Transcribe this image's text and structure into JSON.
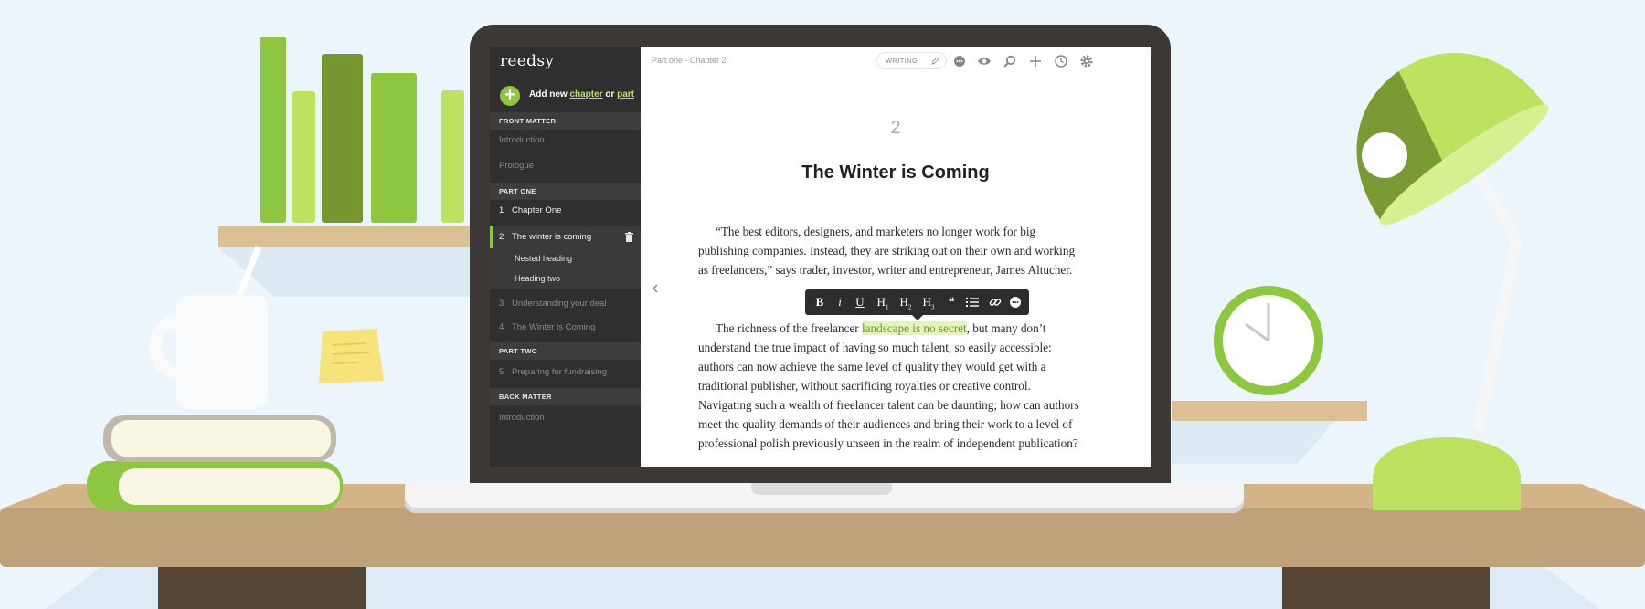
{
  "app": {
    "logo": "reedsy"
  },
  "sidebar": {
    "add_new": {
      "prefix": "Add new ",
      "chapter": "chapter",
      "or": " or ",
      "part": "part"
    },
    "front_matter": {
      "heading": "FRONT MATTER",
      "items": [
        "Introduction",
        "Prologue"
      ]
    },
    "part_one": {
      "heading": "PART ONE",
      "items": [
        {
          "num": "1",
          "label": "Chapter One"
        },
        {
          "num": "2",
          "label": "The winter is coming"
        },
        {
          "num": "3",
          "label": "Understanding your deal"
        },
        {
          "num": "4",
          "label": "The Winter is Coming"
        }
      ],
      "sub_headings": [
        "Nested heading",
        "Heading two"
      ]
    },
    "part_two": {
      "heading": "PART TWO",
      "items": [
        {
          "num": "5",
          "label": "Preparing for fundraising"
        }
      ]
    },
    "back_matter": {
      "heading": "BACK MATTER",
      "items": [
        "Introduction"
      ]
    }
  },
  "toolbar": {
    "breadcrumb": "Part one - Chapter 2",
    "mode": "WRITING",
    "icons": [
      "comment-icon",
      "eye-icon",
      "search-icon",
      "plus-icon",
      "clock-icon",
      "gear-icon"
    ]
  },
  "document": {
    "chapter_number": "2",
    "chapter_title": "The Winter is Coming",
    "p1": "“The best editors, designers, and marketers no longer work for big publishing companies. Instead, they are striking out on their own and working as freelancers,” says trader, investor, writer and entrepreneur, James Altucher.",
    "p2_before": "The richness of the freelancer ",
    "p2_highlight": "landscape is no secret",
    "p2_after": ", but many don’t understand the true impact of having so much talent, so easily accessible: authors can now achieve the same level of quality they would get with a traditional publisher, without sacrificing royalties or creative control. Navigating such a wealth of freelancer talent can be daunting; how can authors meet the quality demands of their audiences and bring their work to a level of professional polish previously unseen in the realm of independent publication?"
  },
  "format_bar": {
    "bold": "B",
    "italic": "i",
    "underline": "U",
    "h1": "H",
    "h1_sub": "1",
    "h2": "H",
    "h2_sub": "2",
    "h3": "H",
    "h3_sub": "3",
    "quote": "❝"
  },
  "colors": {
    "accent": "#8dc63f",
    "sidebar_bg": "#2f2f2f",
    "desk": "#d2b486",
    "background": "#ecf5fb"
  }
}
